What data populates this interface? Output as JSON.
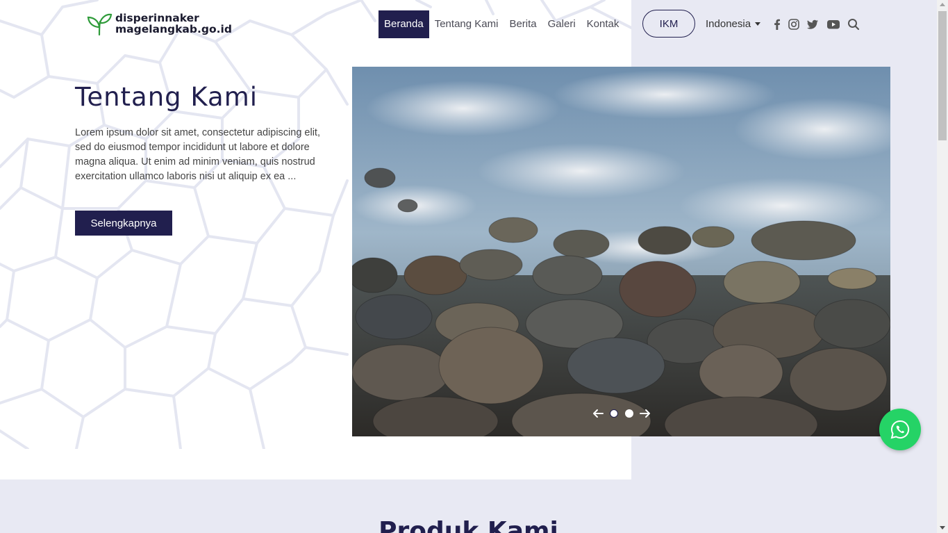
{
  "header": {
    "logo_line1": "disperinnaker",
    "logo_line2": "magelangkab.go.id",
    "nav": [
      {
        "label": "Beranda",
        "active": true
      },
      {
        "label": "Tentang Kami",
        "active": false
      },
      {
        "label": "Berita",
        "active": false
      },
      {
        "label": "Galeri",
        "active": false
      },
      {
        "label": "Kontak",
        "active": false
      }
    ],
    "ikm_label": "IKM",
    "language": "Indonesia",
    "social_icons": [
      "facebook-icon",
      "instagram-icon",
      "twitter-icon",
      "youtube-icon",
      "search-icon"
    ]
  },
  "hero": {
    "title": "Tentang Kami",
    "description": "Lorem ipsum dolor sit amet, consectetur adipiscing elit, sed do eiusmod tempor incididunt ut labore et dolore magna aliqua. Ut enim ad minim veniam, quis nostrud exercitation ullamco laboris nisi ut aliquip ex ea ...",
    "button_label": "Selengkapnya",
    "carousel": {
      "slide_count": 2,
      "current_slide": 2
    }
  },
  "section": {
    "title": "Produk Kami"
  },
  "colors": {
    "primary": "#211f4e",
    "whatsapp": "#25d366",
    "section_bg": "#e8e9f3"
  }
}
